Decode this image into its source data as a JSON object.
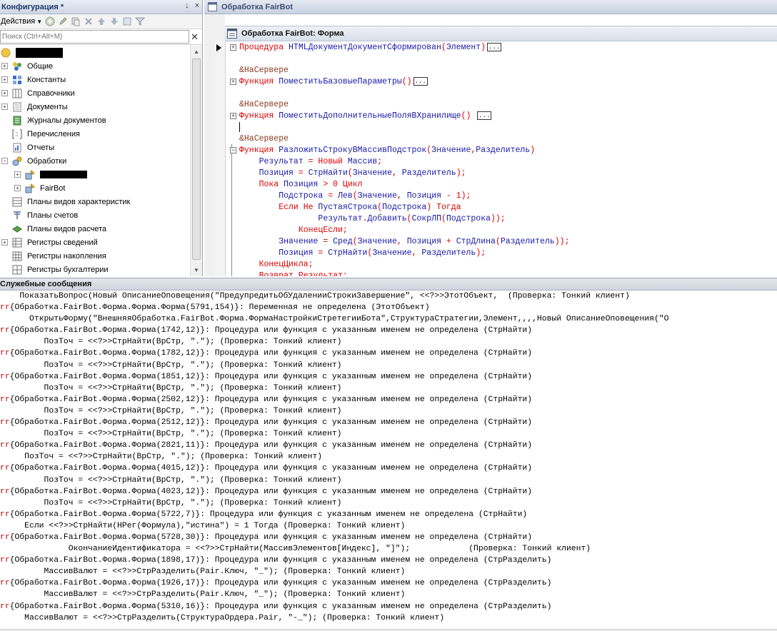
{
  "config": {
    "title": "Конфигурация *",
    "title_controls": [
      "↓",
      "×"
    ],
    "actions_label": "Действия",
    "search_placeholder": "Поиск (Ctrl+Alt+M)",
    "tree": [
      {
        "label": "Общие",
        "icon": "common-icon",
        "expand": "+"
      },
      {
        "label": "Константы",
        "icon": "constants-icon",
        "expand": "+"
      },
      {
        "label": "Справочники",
        "icon": "catalogs-icon",
        "expand": "+"
      },
      {
        "label": "Документы",
        "icon": "documents-icon",
        "expand": "+"
      },
      {
        "label": "Журналы документов",
        "icon": "journals-icon",
        "expand": ""
      },
      {
        "label": "Перечисления",
        "icon": "enums-icon",
        "expand": ""
      },
      {
        "label": "Отчеты",
        "icon": "reports-icon",
        "expand": ""
      },
      {
        "label": "Обработки",
        "icon": "dataprocessors-icon",
        "expand": "−"
      },
      {
        "label": "",
        "icon": "dataprocessor-item-icon",
        "expand": "+",
        "child": true,
        "redacted": true
      },
      {
        "label": "FairBot",
        "icon": "dataprocessor-item-icon",
        "expand": "+",
        "child": true
      },
      {
        "label": "Планы видов характеристик",
        "icon": "chart-of-characteristics-icon",
        "expand": ""
      },
      {
        "label": "Планы счетов",
        "icon": "chart-of-accounts-icon",
        "expand": ""
      },
      {
        "label": "Планы видов расчета",
        "icon": "chart-of-calc-icon",
        "expand": ""
      },
      {
        "label": "Регистры сведений",
        "icon": "info-registers-icon",
        "expand": "+"
      },
      {
        "label": "Регистры накопления",
        "icon": "accum-registers-icon",
        "expand": ""
      },
      {
        "label": "Регистры бухгалтерии",
        "icon": "acc-registers-icon",
        "expand": ""
      }
    ]
  },
  "processing": {
    "title": "Обработка FairBot",
    "form_title": "Обработка FairBot: Форма"
  },
  "messages_title": "Служебные сообщения",
  "messages": [
    {
      "err": "",
      "text": "    ПоказатьВопрос(Новый ОписаниеОповещения(\"ПредупредитьОбУдаленииСтрокиЗавершение\", <<?>>ЭтотОбъект,  (Проверка: Тонкий клиент)"
    },
    {
      "err": "rr",
      "text": "{Обработка.FairBot.Форма.Форма.Форма(5791,154)}: Переменная не определена (ЭтотОбъект)"
    },
    {
      "err": "",
      "text": "      ОткрытьФорму(\"ВнешняяОбработка.FairBot.Форма.ФормаНастройкиСтретегииБота\",СтруктураСтратегии,Элемент,,,,Новый ОписаниеОповещения(\"О"
    },
    {
      "err": "rr",
      "text": "{Обработка.FairBot.Форма.Форма(1742,12)}: Процедура или функция с указанным именем не определена (СтрНайти)"
    },
    {
      "err": "",
      "text": "         ПозТоч = <<?>>СтрНайти(ВрСтр, \".\"); (Проверка: Тонкий клиент)"
    },
    {
      "err": "rr",
      "text": "{Обработка.FairBot.Форма.Форма(1782,12)}: Процедура или функция с указанным именем не определена (СтрНайти)"
    },
    {
      "err": "",
      "text": "         ПозТоч = <<?>>СтрНайти(ВрСтр, \".\"); (Проверка: Тонкий клиент)"
    },
    {
      "err": "rr",
      "text": "{Обработка.FairBot.Форма.Форма(1851,12)}: Процедура или функция с указанным именем не определена (СтрНайти)"
    },
    {
      "err": "",
      "text": "         ПозТоч = <<?>>СтрНайти(ВрСтр, \".\"); (Проверка: Тонкий клиент)"
    },
    {
      "err": "rr",
      "text": "{Обработка.FairBot.Форма.Форма(2502,12)}: Процедура или функция с указанным именем не определена (СтрНайти)"
    },
    {
      "err": "",
      "text": "         ПозТоч = <<?>>СтрНайти(ВрСтр, \".\"); (Проверка: Тонкий клиент)"
    },
    {
      "err": "rr",
      "text": "{Обработка.FairBot.Форма.Форма(2512,12)}: Процедура или функция с указанным именем не определена (СтрНайти)"
    },
    {
      "err": "",
      "text": "         ПозТоч = <<?>>СтрНайти(ВрСтр, \".\"); (Проверка: Тонкий клиент)"
    },
    {
      "err": "rr",
      "text": "{Обработка.FairBot.Форма.Форма(2821,11)}: Процедура или функция с указанным именем не определена (СтрНайти)"
    },
    {
      "err": "",
      "text": "     ПозТоч = <<?>>СтрНайти(ВрСтр, \".\"); (Проверка: Тонкий клиент)"
    },
    {
      "err": "rr",
      "text": "{Обработка.FairBot.Форма.Форма(4015,12)}: Процедура или функция с указанным именем не определена (СтрНайти)"
    },
    {
      "err": "",
      "text": "         ПозТоч = <<?>>СтрНайти(ВрСтр, \".\"); (Проверка: Тонкий клиент)"
    },
    {
      "err": "rr",
      "text": "{Обработка.FairBot.Форма.Форма(4023,12)}: Процедура или функция с указанным именем не определена (СтрНайти)"
    },
    {
      "err": "",
      "text": "         ПозТоч = <<?>>СтрНайти(ВрСтр, \".\"); (Проверка: Тонкий клиент)"
    },
    {
      "err": "rr",
      "text": "{Обработка.FairBot.Форма.Форма(5722,7)}: Процедура или функция с указанным именем не определена (СтрНайти)"
    },
    {
      "err": "",
      "text": "     Если <<?>>СтрНайти(НРег(Формула),\"истина\") = 1 Тогда (Проверка: Тонкий клиент)"
    },
    {
      "err": "rr",
      "text": "{Обработка.FairBot.Форма.Форма(5728,30)}: Процедура или функция с указанным именем не определена (СтрНайти)"
    },
    {
      "err": "",
      "text": "              ОкончаниеИдентификатора = <<?>>СтрНайти(МассивЭлементов[Индекс], \"]\");            (Проверка: Тонкий клиент)"
    },
    {
      "err": "rr",
      "text": "{Обработка.FairBot.Форма.Форма(1898,17)}: Процедура или функция с указанным именем не определена (СтрРазделить)"
    },
    {
      "err": "",
      "text": "         МассивВалют = <<?>>СтрРазделить(Pair.Ключ, \"_\"); (Проверка: Тонкий клиент)"
    },
    {
      "err": "rr",
      "text": "{Обработка.FairBot.Форма.Форма(1926,17)}: Процедура или функция с указанным именем не определена (СтрРазделить)"
    },
    {
      "err": "",
      "text": "         МассивВалют = <<?>>СтрРазделить(Pair.Ключ, \"_\"); (Проверка: Тонкий клиент)"
    },
    {
      "err": "rr",
      "text": "{Обработка.FairBot.Форма.Форма(5310,16)}: Процедура или функция с указанным именем не определена (СтрРазделить)"
    },
    {
      "err": "",
      "text": "     МассивВалют = <<?>>СтрРазделить(СтруктураОрдера.Pair, \"-_\"); (Проверка: Тонкий клиент)"
    }
  ],
  "code": [
    {
      "fold": "+",
      "segs": [
        [
          "kw",
          "Процедура "
        ],
        [
          "fn",
          "HTMLДокументДокументСформирован"
        ],
        [
          "kw",
          "("
        ],
        [
          "fn",
          "Элемент"
        ],
        [
          "kw",
          ")"
        ]
      ],
      "ellipsis": true
    },
    {
      "segs": []
    },
    {
      "segs": [
        [
          "pre",
          "&НаСервере"
        ]
      ]
    },
    {
      "fold": "+",
      "segs": [
        [
          "kw",
          "Функция "
        ],
        [
          "fn",
          "ПоместитьБазовыеПараметры"
        ],
        [
          "kw",
          "()"
        ]
      ],
      "ellipsis": true
    },
    {
      "segs": []
    },
    {
      "segs": [
        [
          "pre",
          "&НаСервере"
        ]
      ]
    },
    {
      "fold": "+",
      "segs": [
        [
          "kw",
          "Функция "
        ],
        [
          "fn",
          "ПоместитьДополнительныеПоляВХранилище"
        ],
        [
          "kw",
          "() "
        ]
      ],
      "ellipsis": true
    },
    {
      "caret": true,
      "segs": []
    },
    {
      "segs": [
        [
          "pre",
          "&НаСервере"
        ]
      ]
    },
    {
      "fold": "−",
      "segs": [
        [
          "kw",
          "Функция "
        ],
        [
          "fn",
          "РазложитьСтрокуВМассивПодстрок"
        ],
        [
          "kw",
          "("
        ],
        [
          "fn",
          "Значение"
        ],
        [
          "kw",
          ","
        ],
        [
          "fn",
          "Разделитель"
        ],
        [
          "kw",
          ")"
        ]
      ]
    },
    {
      "segs": [
        [
          "fn",
          "    Результат "
        ],
        [
          "kw",
          "= Новый "
        ],
        [
          "fn",
          "Массив"
        ],
        [
          "kw",
          ";"
        ]
      ]
    },
    {
      "segs": [
        [
          "fn",
          "    Позиция "
        ],
        [
          "kw",
          "= "
        ],
        [
          "fn",
          "СтрНайти"
        ],
        [
          "kw",
          "("
        ],
        [
          "fn",
          "Значение"
        ],
        [
          "kw",
          ", "
        ],
        [
          "fn",
          "Разделитель"
        ],
        [
          "kw",
          ");"
        ]
      ]
    },
    {
      "segs": [
        [
          "kw",
          "    Пока "
        ],
        [
          "fn",
          "Позиция "
        ],
        [
          "kw",
          "> 0 Цикл"
        ]
      ]
    },
    {
      "segs": [
        [
          "fn",
          "        Подстрока "
        ],
        [
          "kw",
          "= "
        ],
        [
          "fn",
          "Лев"
        ],
        [
          "kw",
          "("
        ],
        [
          "fn",
          "Значение"
        ],
        [
          "kw",
          ", "
        ],
        [
          "fn",
          "Позиция "
        ],
        [
          "kw",
          "- 1);"
        ]
      ]
    },
    {
      "segs": [
        [
          "kw",
          "        Если Не "
        ],
        [
          "fn",
          "ПустаяСтрока"
        ],
        [
          "kw",
          "("
        ],
        [
          "fn",
          "Подстрока"
        ],
        [
          "kw",
          ") Тогда"
        ]
      ]
    },
    {
      "segs": [
        [
          "fn",
          "                Результат"
        ],
        [
          "kw",
          "."
        ],
        [
          "fn",
          "Добавить"
        ],
        [
          "kw",
          "("
        ],
        [
          "fn",
          "СокрЛП"
        ],
        [
          "kw",
          "("
        ],
        [
          "fn",
          "Подстрока"
        ],
        [
          "kw",
          "));"
        ]
      ]
    },
    {
      "segs": [
        [
          "kw",
          "            КонецЕсли;"
        ]
      ]
    },
    {
      "segs": [
        [
          "fn",
          "        Значение "
        ],
        [
          "kw",
          "= "
        ],
        [
          "fn",
          "Сред"
        ],
        [
          "kw",
          "("
        ],
        [
          "fn",
          "Значение"
        ],
        [
          "kw",
          ", "
        ],
        [
          "fn",
          "Позиция "
        ],
        [
          "kw",
          "+ "
        ],
        [
          "fn",
          "СтрДлина"
        ],
        [
          "kw",
          "("
        ],
        [
          "fn",
          "Разделитель"
        ],
        [
          "kw",
          "));"
        ]
      ]
    },
    {
      "segs": [
        [
          "fn",
          "        Позиция "
        ],
        [
          "kw",
          "= "
        ],
        [
          "fn",
          "СтрНайти"
        ],
        [
          "kw",
          "("
        ],
        [
          "fn",
          "Значение"
        ],
        [
          "kw",
          ", "
        ],
        [
          "fn",
          "Разделитель"
        ],
        [
          "kw",
          ");"
        ]
      ]
    },
    {
      "segs": [
        [
          "kw",
          "    КонецЦикла;"
        ]
      ]
    },
    {
      "segs": [
        [
          "kw",
          "    Возврат Результат;"
        ]
      ]
    }
  ]
}
